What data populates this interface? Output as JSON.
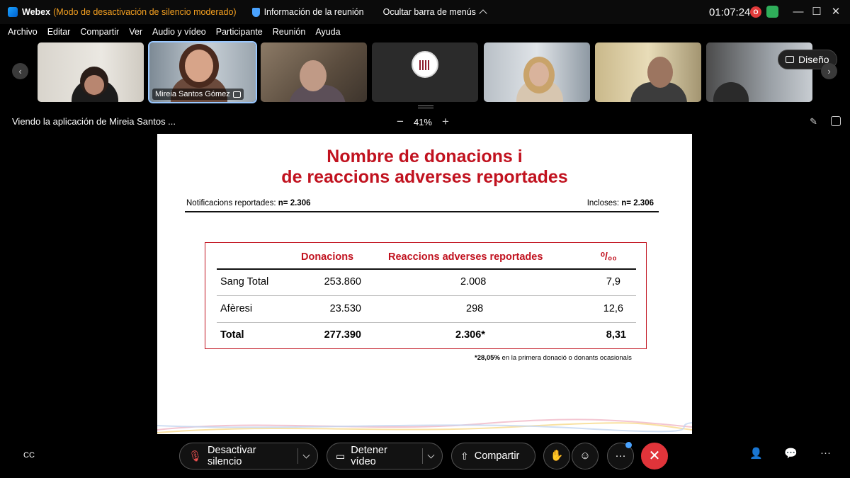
{
  "titlebar": {
    "app_name": "Webex",
    "mode": "(Modo de desactivación de silencio moderado)",
    "meeting_info": "Información de la reunión",
    "hide_menu": "Ocultar barra de menús",
    "clock": "01:07:24",
    "rec_badge": "O"
  },
  "menu": [
    "Archivo",
    "Editar",
    "Compartir",
    "Ver",
    "Audio y vídeo",
    "Participante",
    "Reunión",
    "Ayuda"
  ],
  "participants": {
    "active_name": "Mireia Santos Gómez",
    "layout_button": "Diseño"
  },
  "viewbar": {
    "viewing_text": "Viendo la aplicación de Mireia Santos ...",
    "zoom": "41%",
    "minus": "−",
    "plus": "+"
  },
  "slide": {
    "title_line1": "Nombre de donacions i",
    "title_line2": "de reaccions adverses reportades",
    "left_label": "Notificacions reportades:",
    "left_value": "n= 2.306",
    "right_label": "Incloses:",
    "right_value": "n= 2.306",
    "headers": {
      "donacions": "Donacions",
      "reaccions": "Reaccions adverses reportades",
      "permil": "⁰/₀₀"
    },
    "rows": [
      {
        "label": "Sang Total",
        "donacions": "253.860",
        "reaccions": "2.008",
        "permil": "7,9"
      },
      {
        "label": "Afèresi",
        "donacions": "23.530",
        "reaccions": "298",
        "permil": "12,6"
      },
      {
        "label": "Total",
        "donacions": "277.390",
        "reaccions": "2.306*",
        "permil": "8,31"
      }
    ],
    "footnote_bold": "*28,05%",
    "footnote_rest": " en la primera donació o donants ocasionals"
  },
  "controls": {
    "mute": "Desactivar silencio",
    "video": "Detener vídeo",
    "share": "Compartir",
    "more": "···",
    "leave": "✕"
  },
  "colors": {
    "accent_red": "#c1121f",
    "mode_orange": "#f5a020",
    "leave_red": "#e0343a"
  }
}
